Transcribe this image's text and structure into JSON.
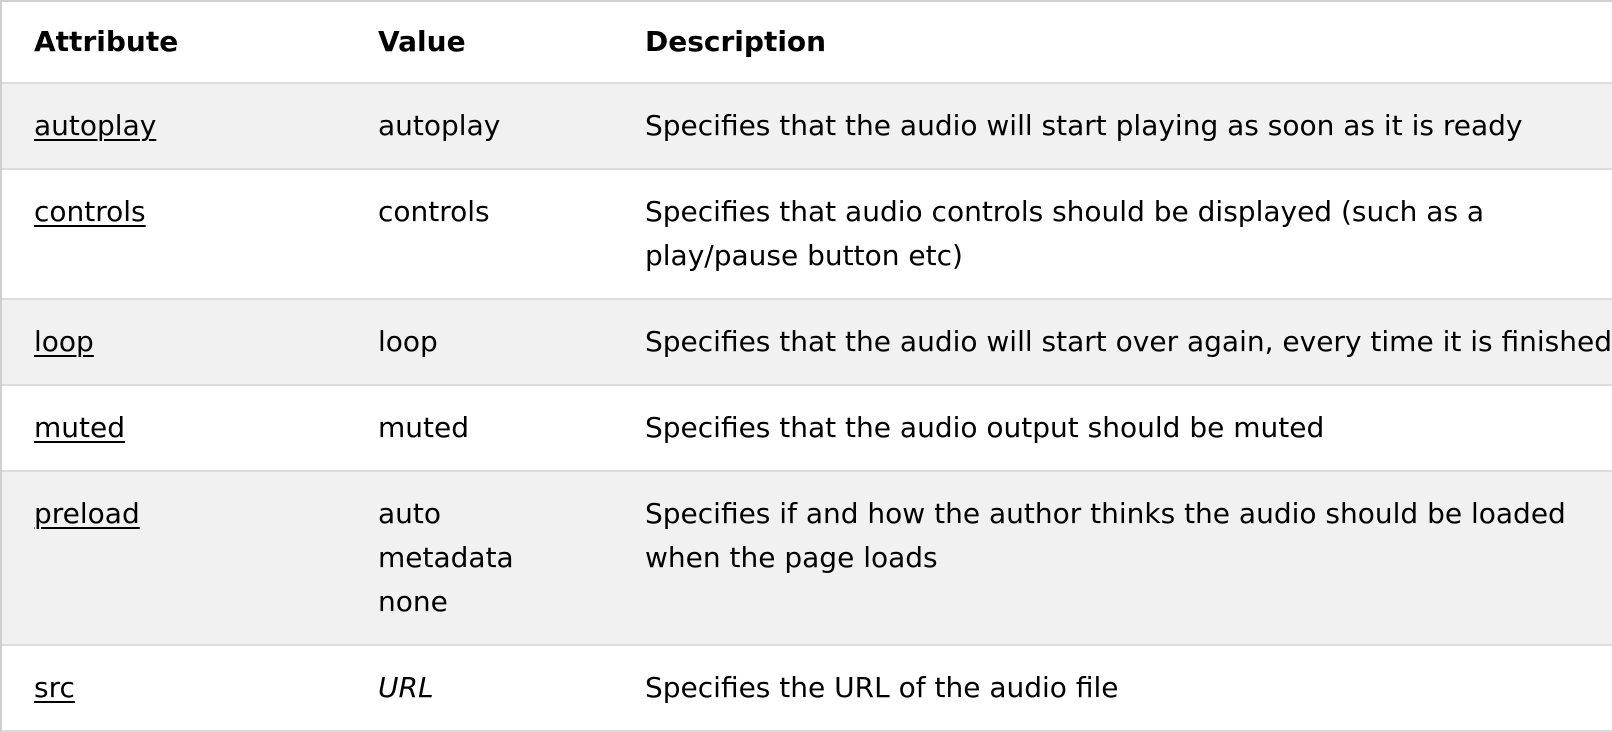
{
  "table": {
    "headers": {
      "attribute": "Attribute",
      "value": "Value",
      "description": "Description"
    },
    "rows": [
      {
        "attribute": "autoplay",
        "values": [
          "autoplay"
        ],
        "value_italic": false,
        "description": "Specifies that the audio will start playing as soon as it is ready"
      },
      {
        "attribute": "controls",
        "values": [
          "controls"
        ],
        "value_italic": false,
        "description": "Specifies that audio controls should be displayed (such as a play/pause button etc)"
      },
      {
        "attribute": "loop",
        "values": [
          "loop"
        ],
        "value_italic": false,
        "description": "Specifies that the audio will start over again, every time it is finished"
      },
      {
        "attribute": "muted",
        "values": [
          "muted"
        ],
        "value_italic": false,
        "description": "Specifies that the audio output should be muted"
      },
      {
        "attribute": "preload",
        "values": [
          "auto",
          "metadata",
          "none"
        ],
        "value_italic": false,
        "description": "Specifies if and how the author thinks the audio should be loaded when the page loads"
      },
      {
        "attribute": "src",
        "values": [
          "URL"
        ],
        "value_italic": true,
        "description": "Specifies the URL of the audio file"
      }
    ]
  },
  "colors": {
    "stripe": "#f1f1f1",
    "background": "#ffffff",
    "border": "#dddddd",
    "text": "#000000"
  }
}
